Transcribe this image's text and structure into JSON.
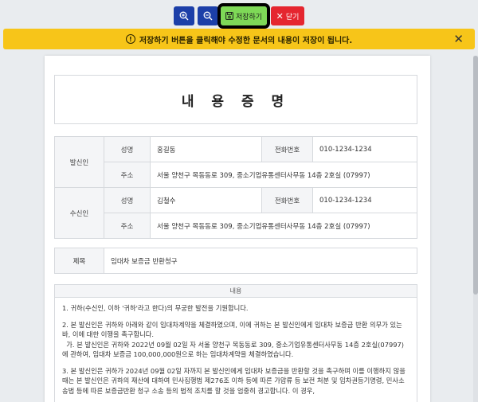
{
  "toolbar": {
    "save_label": "저장하기",
    "close_label": "닫기"
  },
  "notice": {
    "text": "저장하기 버튼을 클릭해야 수정한 문서의 내용이 저장이 됩니다."
  },
  "document": {
    "title": "내 용 증 명",
    "sender": {
      "section_label": "발신인",
      "name_label": "성명",
      "name": "홍길동",
      "phone_label": "전화번호",
      "phone": "010-1234-1234",
      "address_label": "주소",
      "address": "서울 양천구 목동동로 309, 중소기업유통센터사무동 14층 2호실 (07997)"
    },
    "receiver": {
      "section_label": "수신인",
      "name_label": "성명",
      "name": "김철수",
      "phone_label": "전화번호",
      "phone": "010-1234-1234",
      "address_label": "주소",
      "address": "서울 양천구 목동동로 309, 중소기업유통센터사무동 14층 2호실 (07997)"
    },
    "subject_label": "제목",
    "subject": "임대차 보증금 반환청구",
    "content_label": "내용",
    "paragraphs": [
      "1. 귀하(수신인, 이하 '귀하'라고 한다)의 무궁한 발전을 기원합니다.",
      "2. 본 발신인은 귀하와 아래와 같이 임대차계약을 체결하였으며, 이에 귀하는 본 발신인에게 임대차 보증금 반환 의무가 있는바, 이에 대한 이행을 촉구합니다.",
      "  가. 본 발신인은 귀하와 2022년 09월 02일 자 서울 양천구 목동동로 309, 중소기업유통센터사무동 14층 2호실(07997)에 관하여, 임대차 보증금 100,000,000원으로 하는 임대차계약을 체결하였습니다.",
      "3. 본 발신인은 귀하가 2024년 09월 02일 자까지 본 발신인에게 임대차 보증금을 반환할 것을 촉구하며 이를 이행하지 않을 때는 본 발신인은 귀하의 재산에 대하여 민사집행법 제276조 이하 등에 따른 가압류 등 보전 처분 및 임차권등기명령, 민사소송법 등에 따른 보증금반환 청구 소송 등의 법적 조치를 할 것을 엄중히 경고합니다. 이 경우,"
    ]
  }
}
